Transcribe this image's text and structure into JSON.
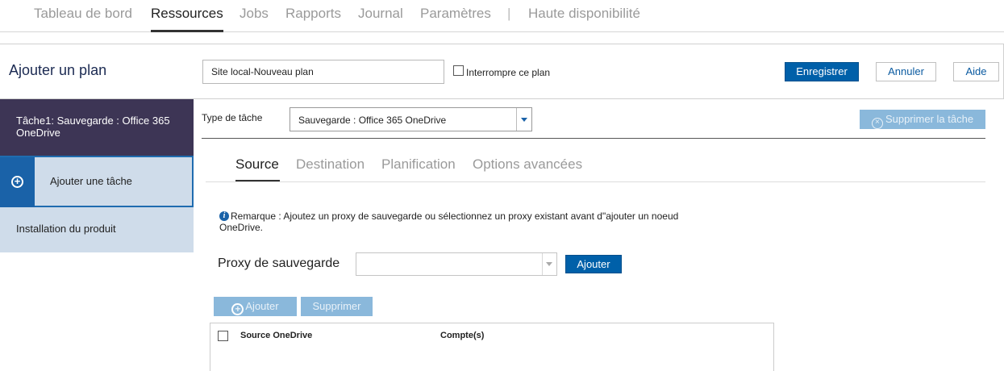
{
  "nav": {
    "items": [
      {
        "label": "Tableau de bord"
      },
      {
        "label": "Ressources",
        "active": true
      },
      {
        "label": "Jobs"
      },
      {
        "label": "Rapports"
      },
      {
        "label": "Journal"
      },
      {
        "label": "Paramètres"
      },
      {
        "label": "Haute disponibilité"
      }
    ],
    "separator": "|"
  },
  "plan": {
    "title": "Ajouter un plan",
    "name_value": "Site local-Nouveau plan",
    "pause_label": "Interrompre ce plan",
    "pause_checked": false,
    "save_label": "Enregistrer",
    "cancel_label": "Annuler",
    "help_label": "Aide"
  },
  "sidebar": {
    "task_label": "Tâche1: Sauvegarde : Office 365 OneDrive",
    "add_task_label": "Ajouter une tâche",
    "install_label": "Installation du produit"
  },
  "task": {
    "type_label": "Type de tâche",
    "type_value": "Sauvegarde : Office 365 OneDrive",
    "delete_label": "Supprimer la tâche"
  },
  "tabs": [
    {
      "label": "Source",
      "active": true
    },
    {
      "label": "Destination"
    },
    {
      "label": "Planification"
    },
    {
      "label": "Options avancées"
    }
  ],
  "note": {
    "line1": "Remarque : Ajoutez un proxy de sauvegarde ou sélectionnez un proxy existant avant d\"ajouter un noeud",
    "line2": "OneDrive."
  },
  "proxy": {
    "label": "Proxy de sauvegarde",
    "value": "",
    "add_label": "Ajouter"
  },
  "source_toolbar": {
    "add_label": "Ajouter",
    "remove_label": "Supprimer"
  },
  "grid": {
    "columns": [
      "Source OneDrive",
      "Compte(s)"
    ],
    "rows": []
  },
  "colors": {
    "primary": "#0060a9",
    "sidebar_active": "#3d3555",
    "sidebar_light": "#cfdcea",
    "disabled_button": "#8ab8db"
  }
}
